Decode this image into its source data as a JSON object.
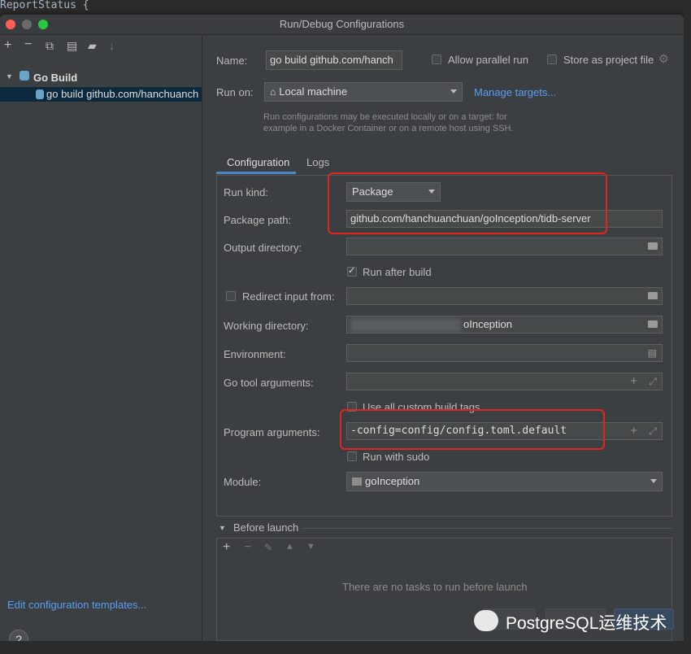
{
  "background_code": "ReportStatus {",
  "window": {
    "title": "Run/Debug Configurations"
  },
  "sidebar": {
    "group_label": "Go Build",
    "item_label": "go build github.com/hanchuanch",
    "edit_templates": "Edit configuration templates..."
  },
  "form": {
    "name_label": "Name:",
    "name_value": "go build github.com/hanch",
    "allow_parallel": "Allow parallel run",
    "store_project": "Store as project file",
    "run_on_label": "Run on:",
    "run_on_value": "Local machine",
    "manage_targets": "Manage targets...",
    "hint_line1": "Run configurations may be executed locally or on a target: for",
    "hint_line2": "example in a Docker Container or on a remote host using SSH."
  },
  "tabs": {
    "configuration": "Configuration",
    "logs": "Logs"
  },
  "config": {
    "run_kind_label": "Run kind:",
    "run_kind_value": "Package",
    "package_path_label": "Package path:",
    "package_path_value": "github.com/hanchuanchuan/goInception/tidb-server",
    "output_dir_label": "Output directory:",
    "run_after_build": "Run after build",
    "redirect_input": "Redirect input from:",
    "working_dir_label": "Working directory:",
    "working_dir_value": "oInception",
    "environment_label": "Environment:",
    "go_tool_args_label": "Go tool arguments:",
    "use_custom_tags": "Use all custom build tags",
    "program_args_label": "Program arguments:",
    "program_args_value": "-config=config/config.toml.default",
    "run_with_sudo": "Run with sudo",
    "module_label": "Module:",
    "module_value": "goInception"
  },
  "before_launch": {
    "title": "Before launch",
    "empty": "There are no tasks to run before launch"
  },
  "footer": {
    "help": "?",
    "watermark": "PostgreSQL运维技术"
  },
  "colors": {
    "accent": "#589df6",
    "highlight": "#e0261b",
    "selection": "#0d293e"
  }
}
